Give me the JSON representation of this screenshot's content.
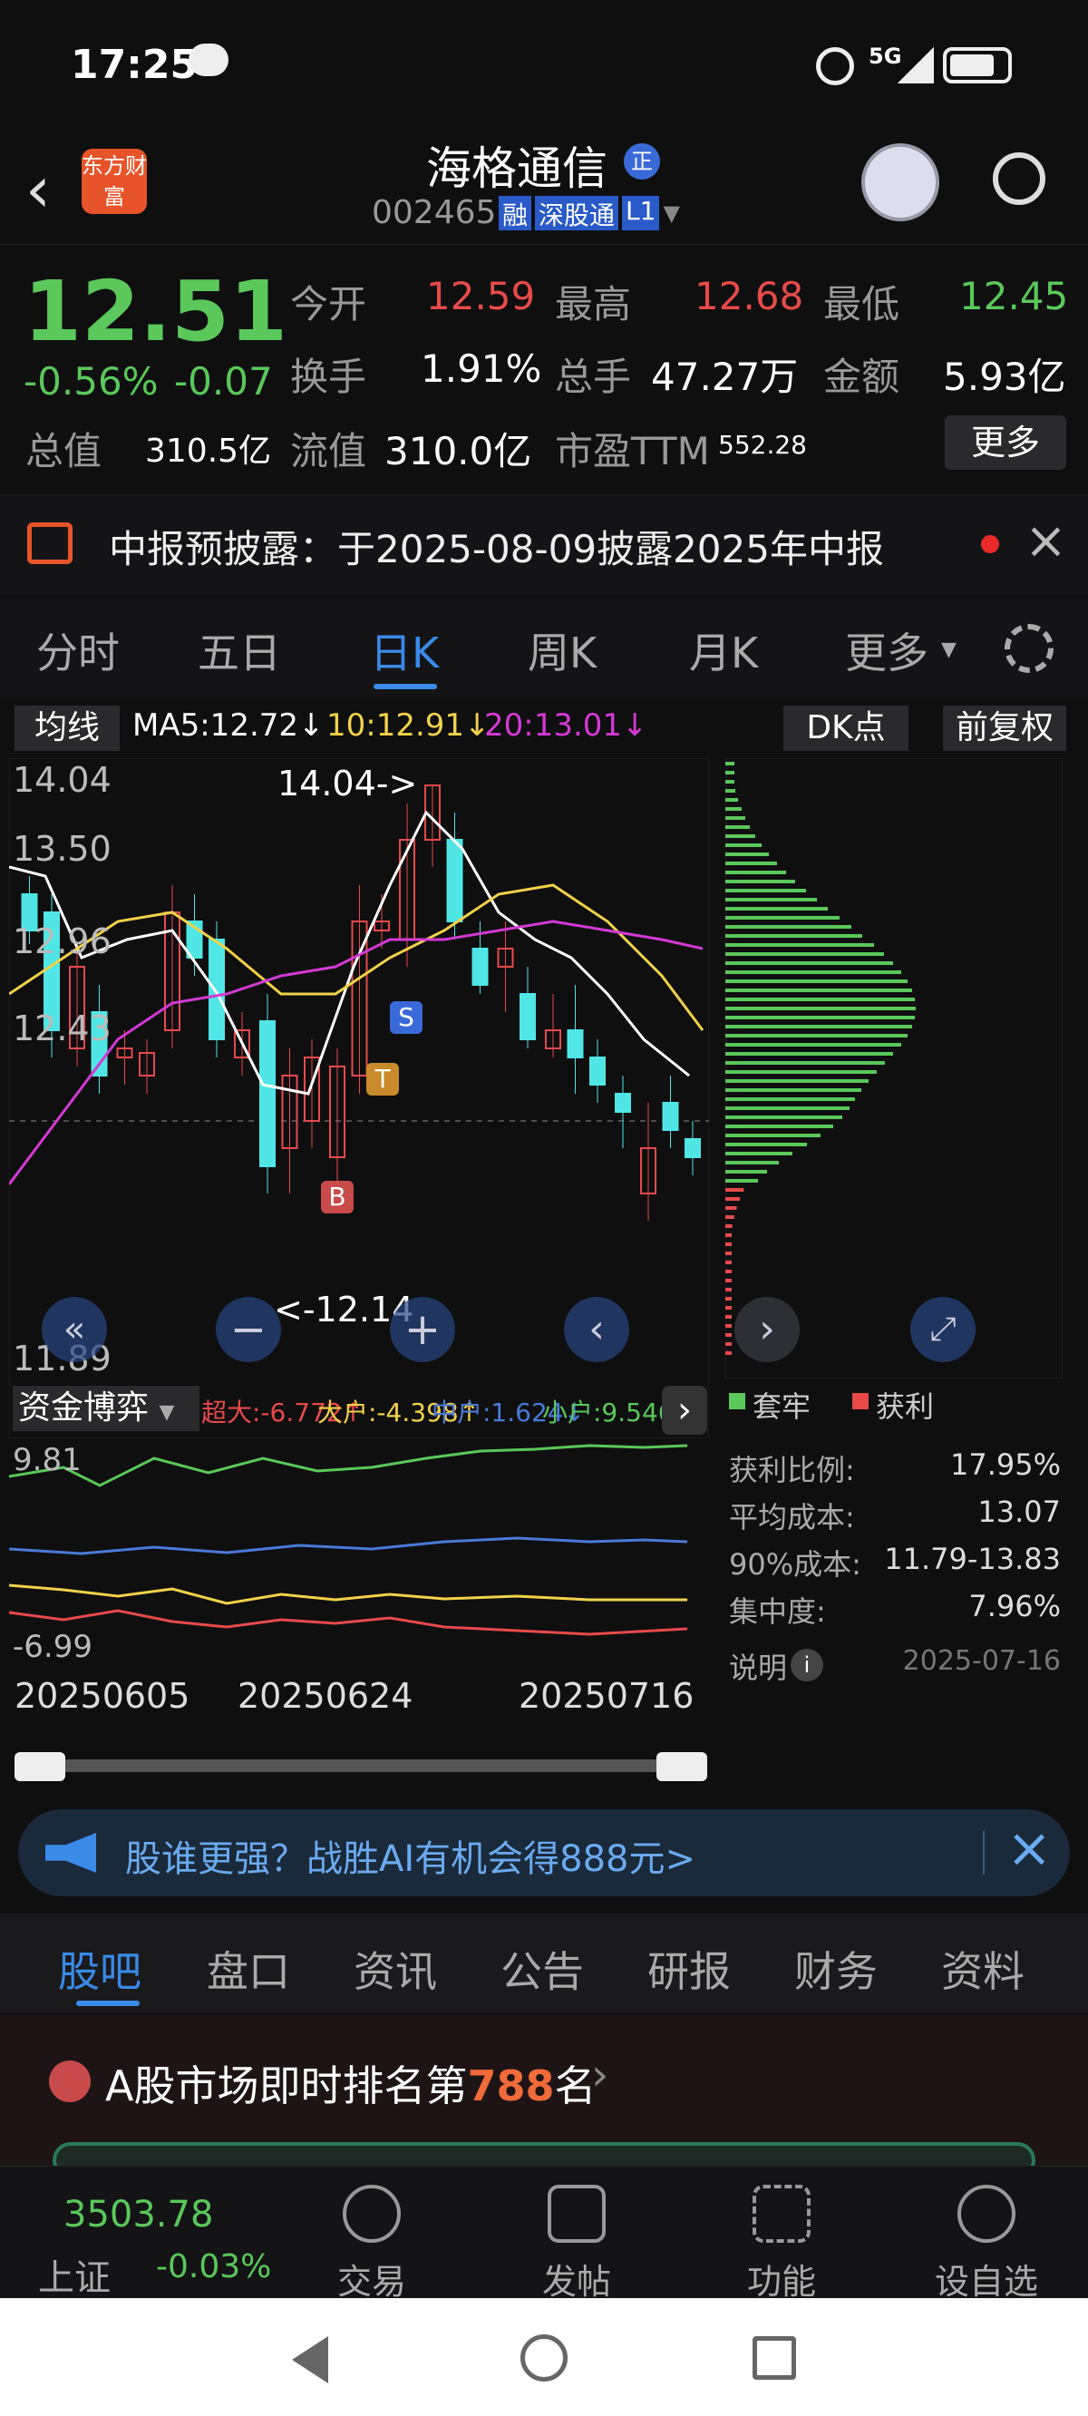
{
  "status": {
    "time": "17:25",
    "network": "5G"
  },
  "header": {
    "title": "海格通信",
    "badge": "正",
    "code": "002465",
    "tags": [
      "融",
      "深股通",
      "L1"
    ],
    "app_logo": "东方财富"
  },
  "quote": {
    "price": "12.51",
    "change_pct": "-0.56%",
    "change": "-0.07",
    "fields": [
      {
        "label": "今开",
        "value": "12.59",
        "color": "red"
      },
      {
        "label": "最高",
        "value": "12.68",
        "color": "red"
      },
      {
        "label": "最低",
        "value": "12.45",
        "color": "green"
      },
      {
        "label": "换手",
        "value": "1.91%",
        "color": "white"
      },
      {
        "label": "总手",
        "value": "47.27万",
        "color": "white"
      },
      {
        "label": "金额",
        "value": "5.93亿",
        "color": "white"
      },
      {
        "label": "总值",
        "value": "310.5亿",
        "color": "white"
      },
      {
        "label": "流值",
        "value": "310.0亿",
        "color": "white"
      },
      {
        "label": "市盈TTM",
        "value": "552.28",
        "color": "white"
      }
    ],
    "more_label": "更多"
  },
  "notice": {
    "text": "中报预披露：于2025-08-09披露2025年中报"
  },
  "chart_tabs": [
    "分时",
    "五日",
    "日K",
    "周K",
    "月K",
    "更多"
  ],
  "active_tab": "日K",
  "ma_bar": {
    "selector": "均线",
    "ma5": "MA5:12.72↓",
    "ma10": "10:12.91↓",
    "ma20": "20:13.01↓",
    "dk": "DK点",
    "adjust": "前复权"
  },
  "kline": {
    "y_labels": [
      "14.04",
      "13.50",
      "12.96",
      "12.43",
      "11.89"
    ],
    "high_label": "14.04->",
    "low_label": "<-12.14",
    "markers": [
      "S",
      "T",
      "B"
    ]
  },
  "flow": {
    "selector": "资金博弈",
    "legend": [
      {
        "text": "超大:-6.772↑",
        "color": "#e84a4a"
      },
      {
        "text": "大户:-4.398↑",
        "color": "#f2d24a"
      },
      {
        "text": "中户:1.624↓",
        "color": "#4a7ad8"
      },
      {
        "text": "小户:9.546↑",
        "color": "#5ac85a"
      }
    ],
    "y_top": "9.81",
    "y_bottom": "-6.99",
    "dates": [
      "20250605",
      "20250624",
      "20250716"
    ]
  },
  "chip": {
    "legend": [
      {
        "text": "套牢",
        "color": "#5ac85a"
      },
      {
        "text": "获利",
        "color": "#e84a4a"
      }
    ],
    "rows": [
      {
        "label": "获利比例:",
        "value": "17.95%"
      },
      {
        "label": "平均成本:",
        "value": "13.07"
      },
      {
        "label": "90%成本:",
        "value": "11.79-13.83"
      },
      {
        "label": "集中度:",
        "value": "7.96%"
      }
    ],
    "note_label": "说明",
    "date": "2025-07-16"
  },
  "promo": {
    "text": "股谁更强？战胜AI有机会得888元>"
  },
  "bottom_tabs": [
    "股吧",
    "盘口",
    "资讯",
    "公告",
    "研报",
    "财务",
    "资料"
  ],
  "rank": {
    "prefix": "A股市场即时排名第",
    "rank": "788",
    "suffix": "名"
  },
  "index": {
    "value": "3503.78",
    "name": "上证",
    "change": "-0.03%"
  },
  "dock": [
    "交易",
    "发帖",
    "功能",
    "设自选"
  ],
  "colors": {
    "up": "#e84a4a",
    "down": "#5ac85a",
    "accent": "#3a8ae8"
  },
  "chart_data": {
    "type": "candlestick",
    "y_range": [
      11.89,
      14.04
    ],
    "ma": {
      "MA5": "12.72",
      "MA10": "12.91",
      "MA20": "13.01"
    }
  }
}
